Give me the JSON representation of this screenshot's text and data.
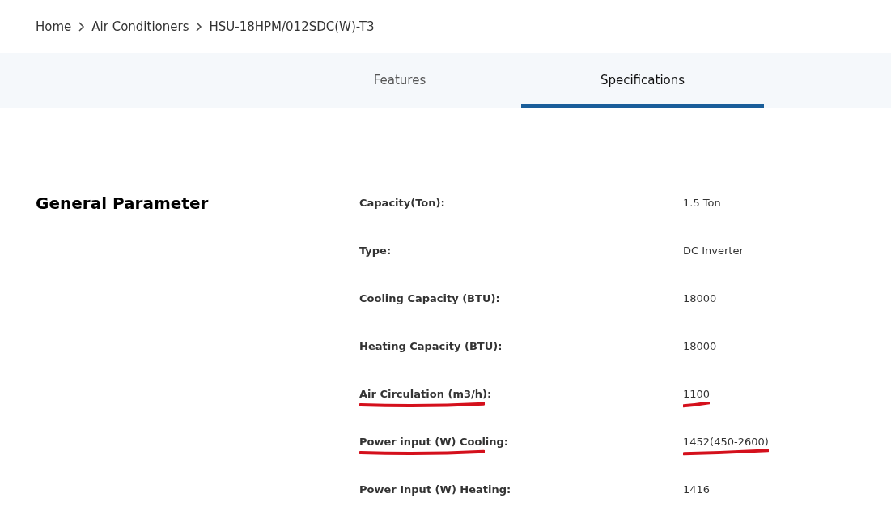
{
  "breadcrumb": [
    {
      "label": "Home"
    },
    {
      "label": "Air Conditioners"
    },
    {
      "label": "HSU-18HPM/012SDC(W)-T3"
    }
  ],
  "tabs": [
    {
      "label": "Features",
      "selected": false
    },
    {
      "label": "Specifications",
      "selected": true
    }
  ],
  "section": {
    "title": "General Parameter"
  },
  "specs": [
    {
      "label": "Capacity(Ton):",
      "value": "1.5 Ton",
      "underlined": false
    },
    {
      "label": "Type:",
      "value": "DC Inverter",
      "underlined": false
    },
    {
      "label": "Cooling Capacity (BTU):",
      "value": "18000",
      "underlined": false
    },
    {
      "label": "Heating Capacity (BTU):",
      "value": "18000",
      "underlined": false
    },
    {
      "label": "Air Circulation (m3/h):",
      "value": "1100",
      "underlined": true
    },
    {
      "label": "Power input (W) Cooling:",
      "value": "1452(450-2600)",
      "underlined": true
    },
    {
      "label": "Power Input (W) Heating:",
      "value": "1416",
      "underlined": false
    }
  ]
}
